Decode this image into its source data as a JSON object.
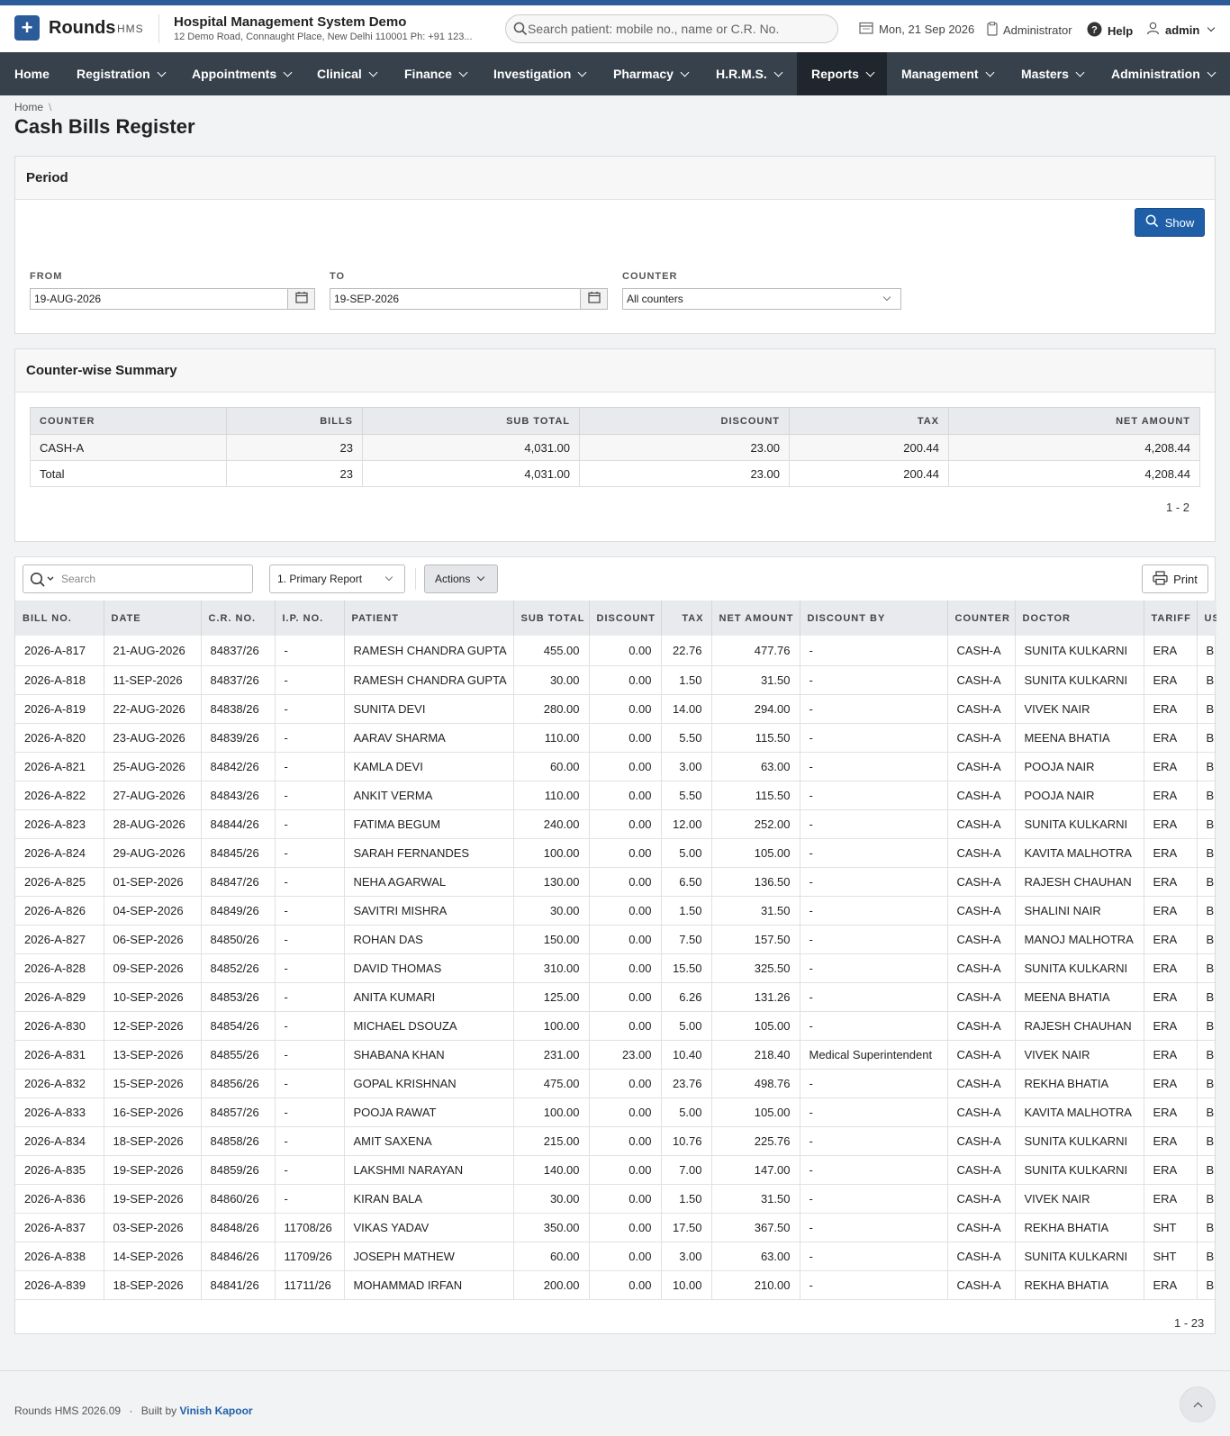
{
  "header": {
    "brand": "Rounds",
    "brand_sub": "HMS",
    "hospital_name": "Hospital Management System Demo",
    "hospital_address": "12 Demo Road, Connaught Place, New Delhi 110001 Ph: +91 123...",
    "search_placeholder": "Search patient: mobile no., name or C.R. No.",
    "date": "Mon, 21 Sep 2026",
    "role": "Administrator",
    "help": "Help",
    "user": "admin"
  },
  "nav": {
    "home": "Home",
    "registration": "Registration",
    "appointments": "Appointments",
    "clinical": "Clinical",
    "finance": "Finance",
    "investigation": "Investigation",
    "pharmacy": "Pharmacy",
    "hrms": "H.R.M.S.",
    "reports": "Reports",
    "management": "Management",
    "masters": "Masters",
    "administration": "Administration"
  },
  "breadcrumb": {
    "home": "Home",
    "sep": "\\"
  },
  "page_title": "Cash Bills Register",
  "period": {
    "heading": "Period",
    "show_label": "Show",
    "from_label": "FROM",
    "from_value": "19-AUG-2026",
    "to_label": "TO",
    "to_value": "19-SEP-2026",
    "counter_label": "COUNTER",
    "counter_value": "All counters"
  },
  "summary": {
    "heading": "Counter-wise Summary",
    "headers": [
      "COUNTER",
      "BILLS",
      "SUB TOTAL",
      "DISCOUNT",
      "TAX",
      "NET AMOUNT"
    ],
    "rows": [
      [
        "CASH-A",
        "23",
        "4,031.00",
        "23.00",
        "200.44",
        "4,208.44"
      ],
      [
        "Total",
        "23",
        "4,031.00",
        "23.00",
        "200.44",
        "4,208.44"
      ]
    ],
    "pager": "1 - 2"
  },
  "report": {
    "search_placeholder": "Search",
    "report_select": "1. Primary Report",
    "actions_label": "Actions",
    "print_label": "Print",
    "headers": [
      "BILL NO.",
      "DATE",
      "C.R. NO.",
      "I.P. NO.",
      "PATIENT",
      "SUB TOTAL",
      "DISCOUNT",
      "TAX",
      "NET AMOUNT",
      "DISCOUNT BY",
      "COUNTER",
      "DOCTOR",
      "TARIFF",
      "USER"
    ],
    "rows": [
      [
        "2026-A-817",
        "21-AUG-2026",
        "84837/26",
        "-",
        "RAMESH CHANDRA GUPTA",
        "455.00",
        "0.00",
        "22.76",
        "477.76",
        "-",
        "CASH-A",
        "SUNITA KULKARNI",
        "ERA",
        "B"
      ],
      [
        "2026-A-818",
        "11-SEP-2026",
        "84837/26",
        "-",
        "RAMESH CHANDRA GUPTA",
        "30.00",
        "0.00",
        "1.50",
        "31.50",
        "-",
        "CASH-A",
        "SUNITA KULKARNI",
        "ERA",
        "B"
      ],
      [
        "2026-A-819",
        "22-AUG-2026",
        "84838/26",
        "-",
        "SUNITA DEVI",
        "280.00",
        "0.00",
        "14.00",
        "294.00",
        "-",
        "CASH-A",
        "VIVEK NAIR",
        "ERA",
        "B"
      ],
      [
        "2026-A-820",
        "23-AUG-2026",
        "84839/26",
        "-",
        "AARAV SHARMA",
        "110.00",
        "0.00",
        "5.50",
        "115.50",
        "-",
        "CASH-A",
        "MEENA BHATIA",
        "ERA",
        "B"
      ],
      [
        "2026-A-821",
        "25-AUG-2026",
        "84842/26",
        "-",
        "KAMLA DEVI",
        "60.00",
        "0.00",
        "3.00",
        "63.00",
        "-",
        "CASH-A",
        "POOJA NAIR",
        "ERA",
        "B"
      ],
      [
        "2026-A-822",
        "27-AUG-2026",
        "84843/26",
        "-",
        "ANKIT VERMA",
        "110.00",
        "0.00",
        "5.50",
        "115.50",
        "-",
        "CASH-A",
        "POOJA NAIR",
        "ERA",
        "B"
      ],
      [
        "2026-A-823",
        "28-AUG-2026",
        "84844/26",
        "-",
        "FATIMA BEGUM",
        "240.00",
        "0.00",
        "12.00",
        "252.00",
        "-",
        "CASH-A",
        "SUNITA KULKARNI",
        "ERA",
        "B"
      ],
      [
        "2026-A-824",
        "29-AUG-2026",
        "84845/26",
        "-",
        "SARAH FERNANDES",
        "100.00",
        "0.00",
        "5.00",
        "105.00",
        "-",
        "CASH-A",
        "KAVITA MALHOTRA",
        "ERA",
        "B"
      ],
      [
        "2026-A-825",
        "01-SEP-2026",
        "84847/26",
        "-",
        "NEHA AGARWAL",
        "130.00",
        "0.00",
        "6.50",
        "136.50",
        "-",
        "CASH-A",
        "RAJESH CHAUHAN",
        "ERA",
        "B"
      ],
      [
        "2026-A-826",
        "04-SEP-2026",
        "84849/26",
        "-",
        "SAVITRI MISHRA",
        "30.00",
        "0.00",
        "1.50",
        "31.50",
        "-",
        "CASH-A",
        "SHALINI NAIR",
        "ERA",
        "B"
      ],
      [
        "2026-A-827",
        "06-SEP-2026",
        "84850/26",
        "-",
        "ROHAN DAS",
        "150.00",
        "0.00",
        "7.50",
        "157.50",
        "-",
        "CASH-A",
        "MANOJ MALHOTRA",
        "ERA",
        "B"
      ],
      [
        "2026-A-828",
        "09-SEP-2026",
        "84852/26",
        "-",
        "DAVID THOMAS",
        "310.00",
        "0.00",
        "15.50",
        "325.50",
        "-",
        "CASH-A",
        "SUNITA KULKARNI",
        "ERA",
        "B"
      ],
      [
        "2026-A-829",
        "10-SEP-2026",
        "84853/26",
        "-",
        "ANITA KUMARI",
        "125.00",
        "0.00",
        "6.26",
        "131.26",
        "-",
        "CASH-A",
        "MEENA BHATIA",
        "ERA",
        "B"
      ],
      [
        "2026-A-830",
        "12-SEP-2026",
        "84854/26",
        "-",
        "MICHAEL DSOUZA",
        "100.00",
        "0.00",
        "5.00",
        "105.00",
        "-",
        "CASH-A",
        "RAJESH CHAUHAN",
        "ERA",
        "B"
      ],
      [
        "2026-A-831",
        "13-SEP-2026",
        "84855/26",
        "-",
        "SHABANA KHAN",
        "231.00",
        "23.00",
        "10.40",
        "218.40",
        "Medical Superintendent",
        "CASH-A",
        "VIVEK NAIR",
        "ERA",
        "B"
      ],
      [
        "2026-A-832",
        "15-SEP-2026",
        "84856/26",
        "-",
        "GOPAL KRISHNAN",
        "475.00",
        "0.00",
        "23.76",
        "498.76",
        "-",
        "CASH-A",
        "REKHA BHATIA",
        "ERA",
        "B"
      ],
      [
        "2026-A-833",
        "16-SEP-2026",
        "84857/26",
        "-",
        "POOJA RAWAT",
        "100.00",
        "0.00",
        "5.00",
        "105.00",
        "-",
        "CASH-A",
        "KAVITA MALHOTRA",
        "ERA",
        "B"
      ],
      [
        "2026-A-834",
        "18-SEP-2026",
        "84858/26",
        "-",
        "AMIT SAXENA",
        "215.00",
        "0.00",
        "10.76",
        "225.76",
        "-",
        "CASH-A",
        "SUNITA KULKARNI",
        "ERA",
        "B"
      ],
      [
        "2026-A-835",
        "19-SEP-2026",
        "84859/26",
        "-",
        "LAKSHMI NARAYAN",
        "140.00",
        "0.00",
        "7.00",
        "147.00",
        "-",
        "CASH-A",
        "SUNITA KULKARNI",
        "ERA",
        "B"
      ],
      [
        "2026-A-836",
        "19-SEP-2026",
        "84860/26",
        "-",
        "KIRAN BALA",
        "30.00",
        "0.00",
        "1.50",
        "31.50",
        "-",
        "CASH-A",
        "VIVEK NAIR",
        "ERA",
        "B"
      ],
      [
        "2026-A-837",
        "03-SEP-2026",
        "84848/26",
        "11708/26",
        "VIKAS YADAV",
        "350.00",
        "0.00",
        "17.50",
        "367.50",
        "-",
        "CASH-A",
        "REKHA BHATIA",
        "SHT",
        "B"
      ],
      [
        "2026-A-838",
        "14-SEP-2026",
        "84846/26",
        "11709/26",
        "JOSEPH MATHEW",
        "60.00",
        "0.00",
        "3.00",
        "63.00",
        "-",
        "CASH-A",
        "SUNITA KULKARNI",
        "SHT",
        "B"
      ],
      [
        "2026-A-839",
        "18-SEP-2026",
        "84841/26",
        "11711/26",
        "MOHAMMAD IRFAN",
        "200.00",
        "0.00",
        "10.00",
        "210.00",
        "-",
        "CASH-A",
        "REKHA BHATIA",
        "ERA",
        "B"
      ]
    ],
    "pager": "1 - 23"
  },
  "footer": {
    "version": "Rounds HMS 2026.09",
    "dot": "·",
    "built_by": "Built by",
    "author": "Vinish Kapoor"
  },
  "colors": {
    "accent": "#2b5c99",
    "nav_bg": "#37414b",
    "nav_active": "#1f262d",
    "primary_button": "#1f5fa8"
  }
}
